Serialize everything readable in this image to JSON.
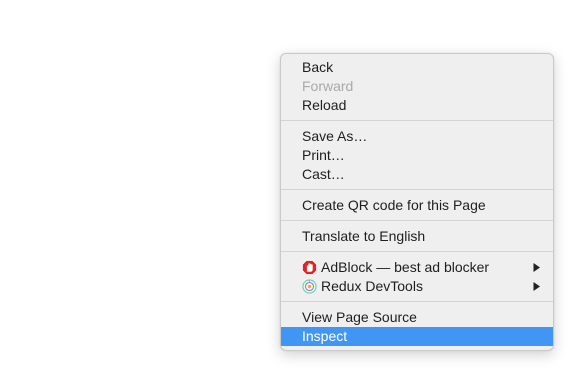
{
  "context_menu": {
    "navigation": [
      {
        "label": "Back",
        "enabled": true
      },
      {
        "label": "Forward",
        "enabled": false
      },
      {
        "label": "Reload",
        "enabled": true
      }
    ],
    "page_actions": [
      {
        "label": "Save As…"
      },
      {
        "label": "Print…"
      },
      {
        "label": "Cast…"
      }
    ],
    "qr_code": {
      "label": "Create QR code for this Page"
    },
    "translate": {
      "label": "Translate to English"
    },
    "extensions": [
      {
        "label": "AdBlock — best ad blocker",
        "icon": "adblock-hand-icon",
        "color": "#e02424",
        "has_submenu": true
      },
      {
        "label": "Redux DevTools",
        "icon": "redux-devtools-icon",
        "color": "#6ad1a4",
        "has_submenu": true
      }
    ],
    "developer": [
      {
        "label": "View Page Source",
        "selected": false
      },
      {
        "label": "Inspect",
        "selected": true
      }
    ],
    "colors": {
      "highlight": "#4196f4",
      "menu_background": "#efefef",
      "disabled_text": "#a9a9a9"
    }
  }
}
